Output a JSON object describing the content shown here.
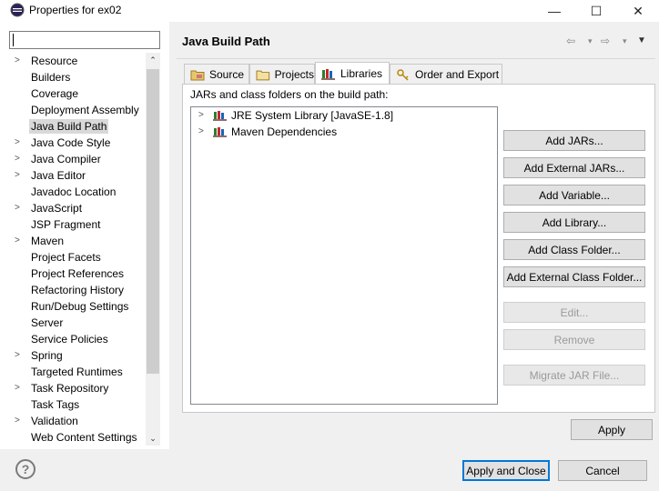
{
  "window": {
    "title": "Properties for ex02",
    "minimize": "—",
    "maximize": "☐",
    "close": "✕"
  },
  "filter": {
    "value": ""
  },
  "tree": {
    "items": [
      {
        "label": "Resource",
        "expandable": true
      },
      {
        "label": "Builders",
        "expandable": false
      },
      {
        "label": "Coverage",
        "expandable": false
      },
      {
        "label": "Deployment Assembly",
        "expandable": false
      },
      {
        "label": "Java Build Path",
        "expandable": false,
        "selected": true
      },
      {
        "label": "Java Code Style",
        "expandable": true
      },
      {
        "label": "Java Compiler",
        "expandable": true
      },
      {
        "label": "Java Editor",
        "expandable": true
      },
      {
        "label": "Javadoc Location",
        "expandable": false
      },
      {
        "label": "JavaScript",
        "expandable": true
      },
      {
        "label": "JSP Fragment",
        "expandable": false
      },
      {
        "label": "Maven",
        "expandable": true
      },
      {
        "label": "Project Facets",
        "expandable": false
      },
      {
        "label": "Project References",
        "expandable": false
      },
      {
        "label": "Refactoring History",
        "expandable": false
      },
      {
        "label": "Run/Debug Settings",
        "expandable": false
      },
      {
        "label": "Server",
        "expandable": false
      },
      {
        "label": "Service Policies",
        "expandable": false
      },
      {
        "label": "Spring",
        "expandable": true
      },
      {
        "label": "Targeted Runtimes",
        "expandable": false
      },
      {
        "label": "Task Repository",
        "expandable": true
      },
      {
        "label": "Task Tags",
        "expandable": false
      },
      {
        "label": "Validation",
        "expandable": true
      },
      {
        "label": "Web Content Settings",
        "expandable": false
      }
    ],
    "scroll_up": "⌃",
    "scroll_down": "⌄"
  },
  "page": {
    "title": "Java Build Path",
    "nav_back": "⇦",
    "nav_fwd": "⇨",
    "nav_dropdown": "▾",
    "view_menu": "▼"
  },
  "tabs": [
    {
      "label": "Source",
      "icon": "source-folder-icon"
    },
    {
      "label": "Projects",
      "icon": "projects-icon"
    },
    {
      "label": "Libraries",
      "icon": "libraries-icon",
      "active": true
    },
    {
      "label": "Order and Export",
      "icon": "order-export-icon"
    }
  ],
  "libraries": {
    "caption": "JARs and class folders on the build path:",
    "entries": [
      {
        "label": "JRE System Library [JavaSE-1.8]"
      },
      {
        "label": "Maven Dependencies"
      }
    ]
  },
  "buttons": {
    "add_jars": "Add JARs...",
    "add_external_jars": "Add External JARs...",
    "add_variable": "Add Variable...",
    "add_library": "Add Library...",
    "add_class_folder": "Add Class Folder...",
    "add_external_class_folder": "Add External Class Folder...",
    "edit": "Edit...",
    "remove": "Remove",
    "migrate_jar": "Migrate JAR File...",
    "apply": "Apply",
    "apply_and_close": "Apply and Close",
    "cancel": "Cancel"
  },
  "help": "?"
}
